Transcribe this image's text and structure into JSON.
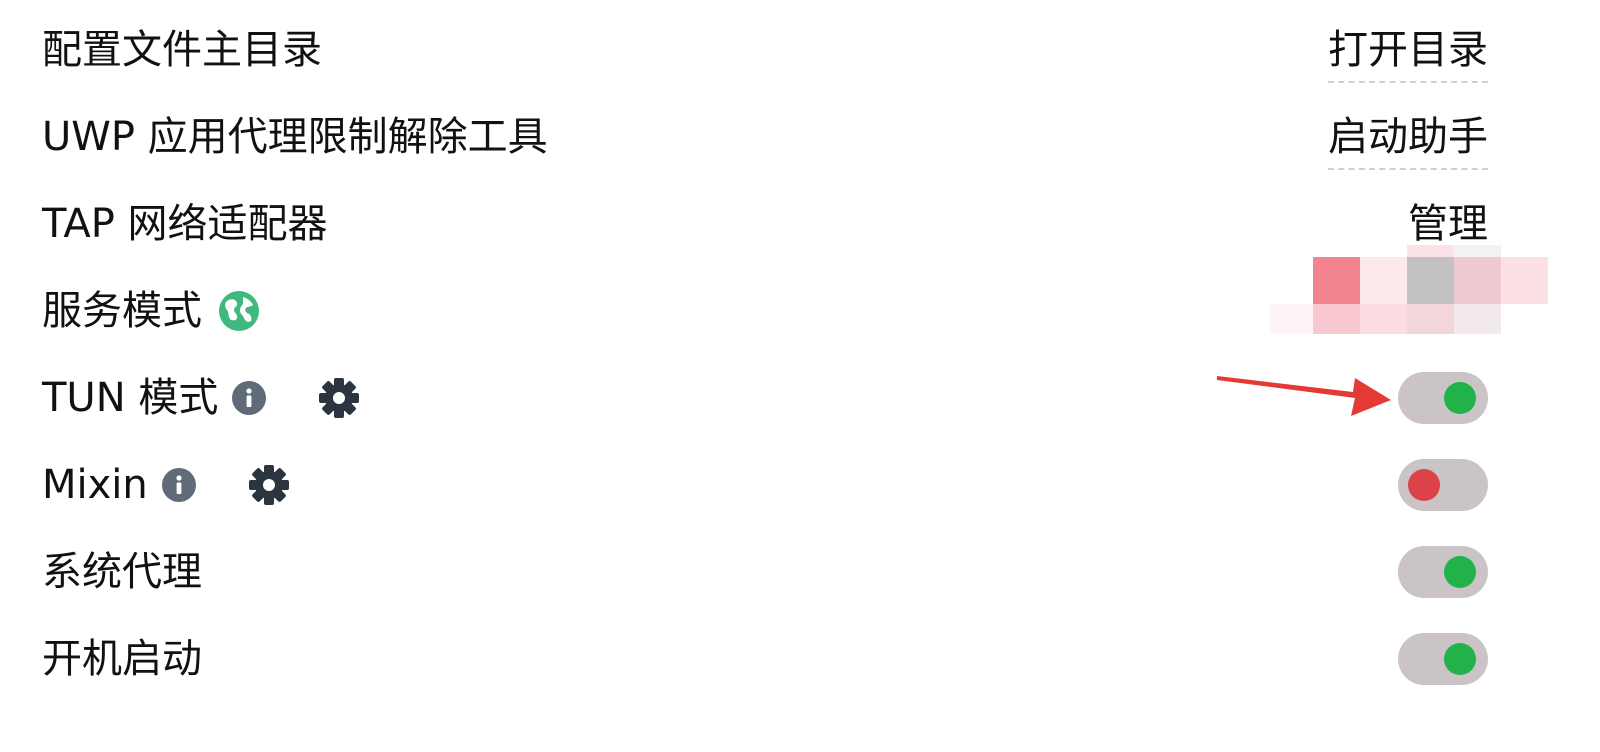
{
  "rows": {
    "profile_dir": {
      "label": "配置文件主目录",
      "action": "打开目录"
    },
    "uwp": {
      "label": "UWP 应用代理限制解除工具",
      "action": "启动助手"
    },
    "tap": {
      "label": "TAP 网络适配器",
      "action": "管理"
    },
    "service": {
      "label": "服务模式"
    },
    "tun": {
      "label": "TUN 模式",
      "state": "on"
    },
    "mixin": {
      "label": "Mixin",
      "state": "off"
    },
    "system_proxy": {
      "label": "系统代理",
      "state": "on"
    },
    "autostart": {
      "label": "开机启动",
      "state": "on"
    }
  },
  "colors": {
    "knob_on": "#21b24a",
    "knob_off": "#dc4248",
    "track": "#cbc4c6",
    "globe": "#3fb980",
    "icon": "#5f6b78",
    "gear": "#2c3440",
    "arrow": "#e53935"
  },
  "icons": {
    "globe": "globe-icon",
    "info": "info-circle-icon",
    "gear": "gear-icon"
  }
}
